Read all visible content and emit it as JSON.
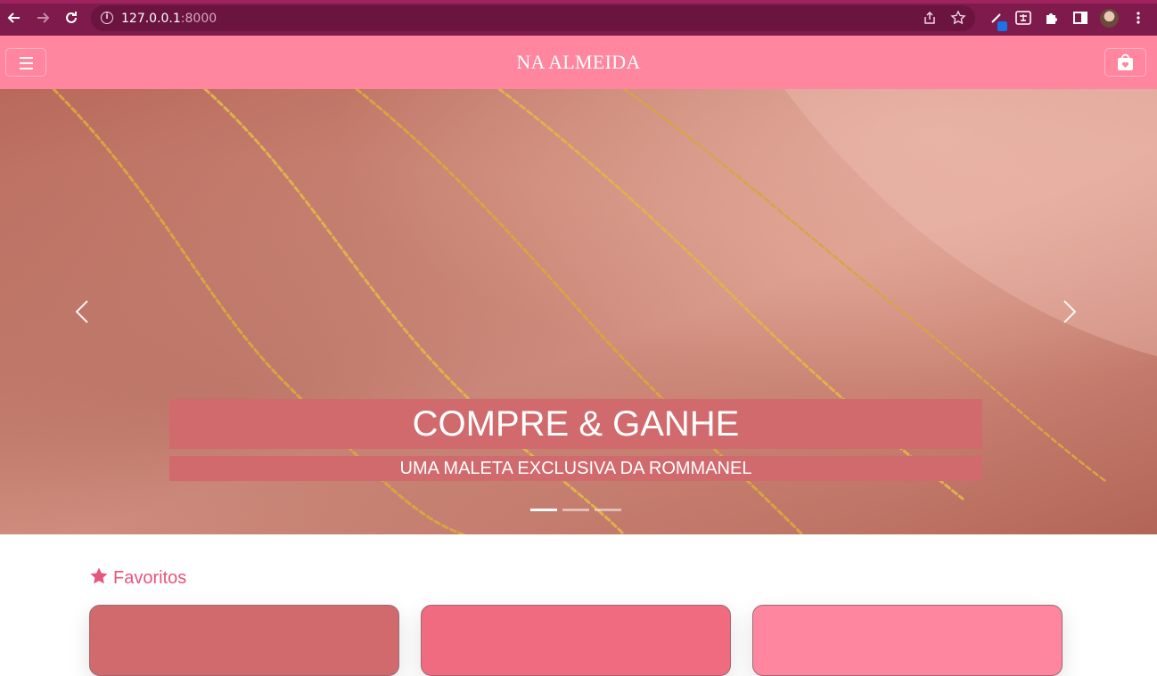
{
  "browser": {
    "url_host": "127.0.0.1",
    "url_port": ":8000",
    "icons": {
      "back": "arrow-left-icon",
      "forward": "arrow-right-icon",
      "reload": "reload-icon",
      "site_info": "info-icon",
      "share": "share-icon",
      "bookmark": "star-icon",
      "extension_pen": "pen-icon",
      "extension_translate": "translate-icon",
      "extensions": "puzzle-icon",
      "side_panel": "side-panel-icon",
      "profile": "avatar",
      "menu": "kebab-menu-icon"
    },
    "colors": {
      "frame": "#7e1a4c",
      "omnibox": "#6a143f"
    }
  },
  "header": {
    "brand": "NA ALMEIDA",
    "menu_icon": "hamburger-icon",
    "cart_icon": "shopping-bag-heart-icon",
    "color": "#ff869e"
  },
  "carousel": {
    "title": "COMPRE & GANHE",
    "subtitle": "UMA MALETA EXCLUSIVA DA ROMMANEL",
    "prev_icon": "chevron-left-icon",
    "next_icon": "chevron-right-icon",
    "slide_count": 3,
    "active_slide": 1,
    "caption_color": "#d16a6d"
  },
  "favorites": {
    "heading": "Favoritos",
    "heading_icon": "star-icon",
    "heading_color": "#e8557b",
    "cards": [
      {
        "color": "#d16a6d"
      },
      {
        "color": "#f06a80"
      },
      {
        "color": "#ff869e"
      }
    ]
  }
}
